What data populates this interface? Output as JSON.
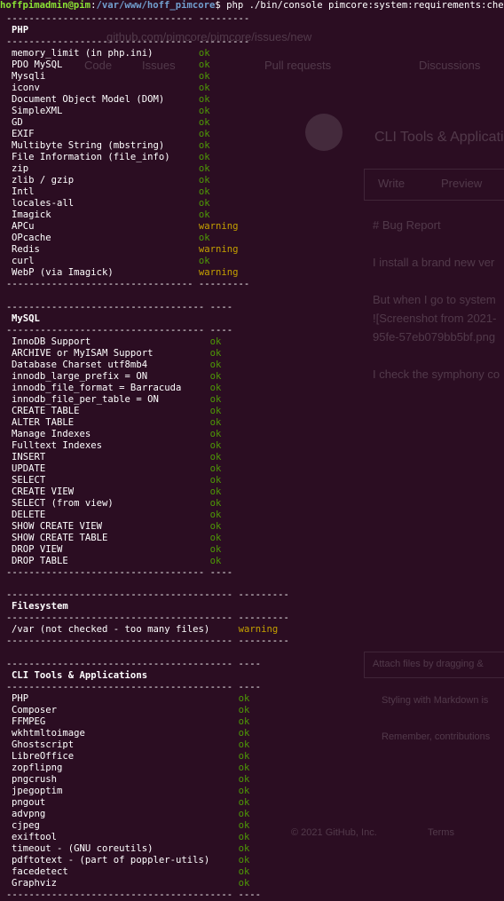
{
  "prompt": {
    "user_host": "hoffpimadmin@pim",
    "separator": ":",
    "path": "/var/www/hoff_pimcore",
    "symbol": "$",
    "command": " php ./bin/console pimcore:system:requirements:check"
  },
  "background_page": {
    "url": "github.com/pimcore/pimcore/issues/new",
    "nav": [
      "Code",
      "Issues",
      "Pull requests",
      "Discussions"
    ],
    "issue_title": "CLI Tools & Applicatio",
    "tabs": [
      "Write",
      "Preview"
    ],
    "body_lines": [
      "# Bug Report",
      "I install a brand new ver",
      "But when I go to system",
      "![Screenshot from 2021-",
      "95fe-57eb079bb5bf.png",
      "I check the symphony co"
    ],
    "attach": "Attach files by dragging &",
    "markdown": "Styling with Markdown is",
    "guidelines": "Remember, contributions",
    "footer": "© 2021 GitHub, Inc.",
    "footer_link": "Terms"
  },
  "sections": [
    {
      "dash_left": "---------------------------------",
      "dash_right": "---------",
      "title": "PHP",
      "checks": [
        {
          "name": "memory_limit (in php.ini)",
          "status": "ok"
        },
        {
          "name": "PDO MySQL",
          "status": "ok"
        },
        {
          "name": "Mysqli",
          "status": "ok"
        },
        {
          "name": "iconv",
          "status": "ok"
        },
        {
          "name": "Document Object Model (DOM)",
          "status": "ok"
        },
        {
          "name": "SimpleXML",
          "status": "ok"
        },
        {
          "name": "GD",
          "status": "ok"
        },
        {
          "name": "EXIF",
          "status": "ok"
        },
        {
          "name": "Multibyte String (mbstring)",
          "status": "ok"
        },
        {
          "name": "File Information (file_info)",
          "status": "ok"
        },
        {
          "name": "zip",
          "status": "ok"
        },
        {
          "name": "zlib / gzip",
          "status": "ok"
        },
        {
          "name": "Intl",
          "status": "ok"
        },
        {
          "name": "locales-all",
          "status": "ok"
        },
        {
          "name": "Imagick",
          "status": "ok"
        },
        {
          "name": "APCu",
          "status": "warning"
        },
        {
          "name": "OPcache",
          "status": "ok"
        },
        {
          "name": "Redis",
          "status": "warning"
        },
        {
          "name": "curl",
          "status": "ok"
        },
        {
          "name": "WebP (via Imagick)",
          "status": "warning"
        }
      ]
    },
    {
      "dash_left": "-----------------------------------",
      "dash_right": "----",
      "title": "MySQL",
      "checks": [
        {
          "name": "InnoDB Support",
          "status": "ok"
        },
        {
          "name": "ARCHIVE or MyISAM Support",
          "status": "ok"
        },
        {
          "name": "Database Charset utf8mb4",
          "status": "ok"
        },
        {
          "name": "innodb_large_prefix = ON",
          "status": "ok"
        },
        {
          "name": "innodb_file_format = Barracuda",
          "status": "ok"
        },
        {
          "name": "innodb_file_per_table = ON",
          "status": "ok"
        },
        {
          "name": "CREATE TABLE",
          "status": "ok"
        },
        {
          "name": "ALTER TABLE",
          "status": "ok"
        },
        {
          "name": "Manage Indexes",
          "status": "ok"
        },
        {
          "name": "Fulltext Indexes",
          "status": "ok"
        },
        {
          "name": "INSERT",
          "status": "ok"
        },
        {
          "name": "UPDATE",
          "status": "ok"
        },
        {
          "name": "SELECT",
          "status": "ok"
        },
        {
          "name": "CREATE VIEW",
          "status": "ok"
        },
        {
          "name": "SELECT (from view)",
          "status": "ok"
        },
        {
          "name": "DELETE",
          "status": "ok"
        },
        {
          "name": "SHOW CREATE VIEW",
          "status": "ok"
        },
        {
          "name": "SHOW CREATE TABLE",
          "status": "ok"
        },
        {
          "name": "DROP VIEW",
          "status": "ok"
        },
        {
          "name": "DROP TABLE",
          "status": "ok"
        }
      ]
    },
    {
      "dash_left": "----------------------------------------",
      "dash_right": "---------",
      "title": "Filesystem",
      "checks": [
        {
          "name": "/var (not checked - too many files)",
          "status": "warning"
        }
      ]
    },
    {
      "dash_left": "----------------------------------------",
      "dash_right": "----",
      "title": "CLI Tools & Applications",
      "checks": [
        {
          "name": "PHP",
          "status": "ok"
        },
        {
          "name": "Composer",
          "status": "ok"
        },
        {
          "name": "FFMPEG",
          "status": "ok"
        },
        {
          "name": "wkhtmltoimage",
          "status": "ok"
        },
        {
          "name": "Ghostscript",
          "status": "ok"
        },
        {
          "name": "LibreOffice",
          "status": "ok"
        },
        {
          "name": "zopflipng",
          "status": "ok"
        },
        {
          "name": "pngcrush",
          "status": "ok"
        },
        {
          "name": "jpegoptim",
          "status": "ok"
        },
        {
          "name": "pngout",
          "status": "ok"
        },
        {
          "name": "advpng",
          "status": "ok"
        },
        {
          "name": "cjpeg",
          "status": "ok"
        },
        {
          "name": "exiftool",
          "status": "ok"
        },
        {
          "name": "timeout - (GNU coreutils)",
          "status": "ok"
        },
        {
          "name": "pdftotext - (part of poppler-utils)",
          "status": "ok"
        },
        {
          "name": "facedetect",
          "status": "ok"
        },
        {
          "name": "Graphviz",
          "status": "ok"
        }
      ]
    }
  ]
}
